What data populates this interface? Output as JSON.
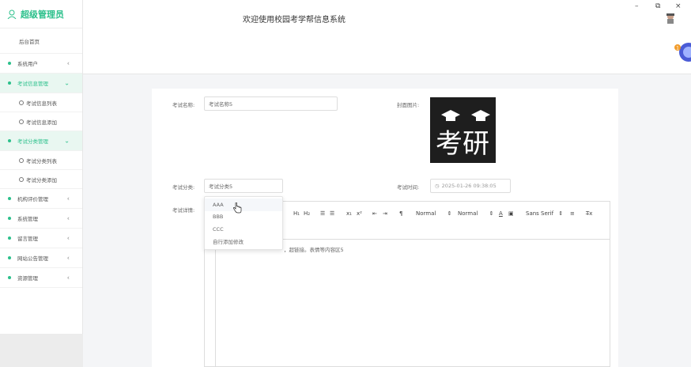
{
  "app": {
    "brand": "超级管理员",
    "header_title": "欢迎使用校园考学帮信息系统",
    "accent": "#2bc08b",
    "notification_count": "1"
  },
  "window": {
    "minimize": "–",
    "restore": "⧉",
    "close": "×"
  },
  "sidebar": {
    "home": "后台首页",
    "items": [
      {
        "label": "系统用户",
        "icon": "chevron-left"
      },
      {
        "label": "考试信息管理",
        "icon": "chevron-down"
      },
      {
        "label": "考试信息列表"
      },
      {
        "label": "考试信息添加"
      },
      {
        "label": "考试分类管理",
        "icon": "chevron-down"
      },
      {
        "label": "考试分类列表"
      },
      {
        "label": "考试分类添加"
      },
      {
        "label": "机构评价管理",
        "icon": "chevron-left"
      },
      {
        "label": "系统管理",
        "icon": "chevron-left"
      },
      {
        "label": "留言管理",
        "icon": "chevron-left"
      },
      {
        "label": "网站公告管理",
        "icon": "chevron-left"
      },
      {
        "label": "资源管理",
        "icon": "chevron-left"
      }
    ]
  },
  "form": {
    "name_label": "考试名称:",
    "name_value": "考试名称5",
    "cover_label": "封面图片:",
    "cover_text": "考研",
    "category_label": "考试分类:",
    "category_value": "考试分类5",
    "time_label": "考试时间:",
    "time_value": "2025-01-26 09:38:05",
    "detail_label": "考试详情:",
    "detail_text": "，超链接。表情等内容区5"
  },
  "dropdown": {
    "options": [
      "AAA",
      "BBB",
      "CCC",
      "自行添加修改"
    ]
  },
  "toolbar": {
    "h1": "H₁",
    "h2": "H₂",
    "list_ordered": "☰",
    "list_bullet": "☰",
    "sub": "x₁",
    "sup": "x²",
    "indent_left": "⇤",
    "indent_right": "⇥",
    "direction": "¶",
    "size1": "Normal",
    "size2": "Normal",
    "font": "Sans Serif",
    "align": "≡",
    "clear": "T̶x"
  }
}
